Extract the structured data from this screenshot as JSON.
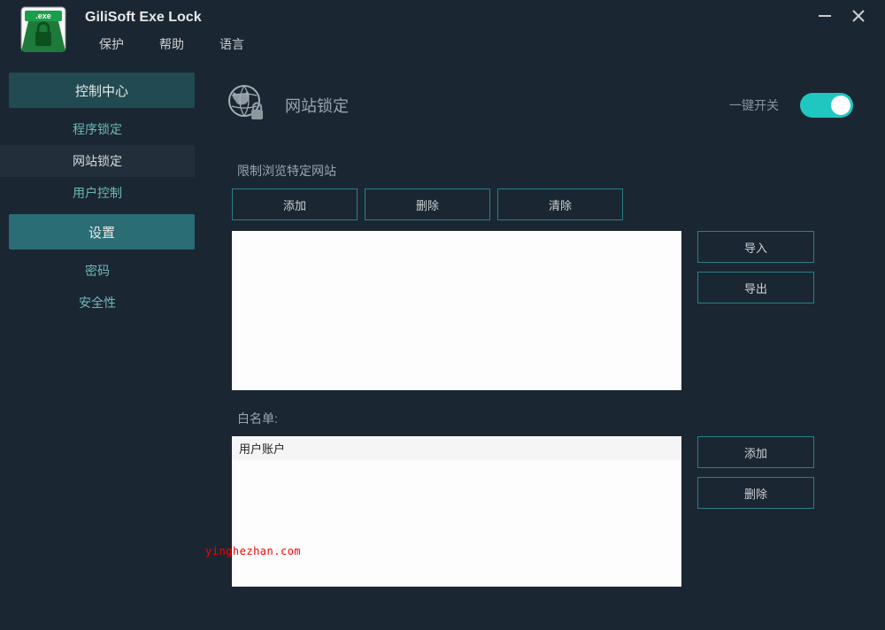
{
  "app": {
    "title": "GiliSoft Exe Lock"
  },
  "menubar": {
    "items": [
      "保护",
      "帮助",
      "语言"
    ]
  },
  "sidebar": {
    "sections": [
      {
        "header": "控制中心",
        "items": [
          {
            "label": "程序锁定",
            "active": false
          },
          {
            "label": "网站锁定",
            "active": true
          },
          {
            "label": "用户控制",
            "active": false
          }
        ]
      },
      {
        "header": "设置",
        "items": [
          {
            "label": "密码",
            "active": false
          },
          {
            "label": "安全性",
            "active": false
          }
        ]
      }
    ]
  },
  "page": {
    "title": "网站锁定",
    "toggle_label": "一键开关",
    "toggle_on": true,
    "restrict": {
      "label": "限制浏览特定网站",
      "buttons": {
        "add": "添加",
        "delete": "删除",
        "clear": "清除"
      },
      "side": {
        "import": "导入",
        "export": "导出"
      },
      "items": []
    },
    "whitelist": {
      "label": "白名单:",
      "side": {
        "add": "添加",
        "delete": "删除"
      },
      "items": [
        "用户账户"
      ]
    }
  },
  "watermark": "yinghezhan.com"
}
